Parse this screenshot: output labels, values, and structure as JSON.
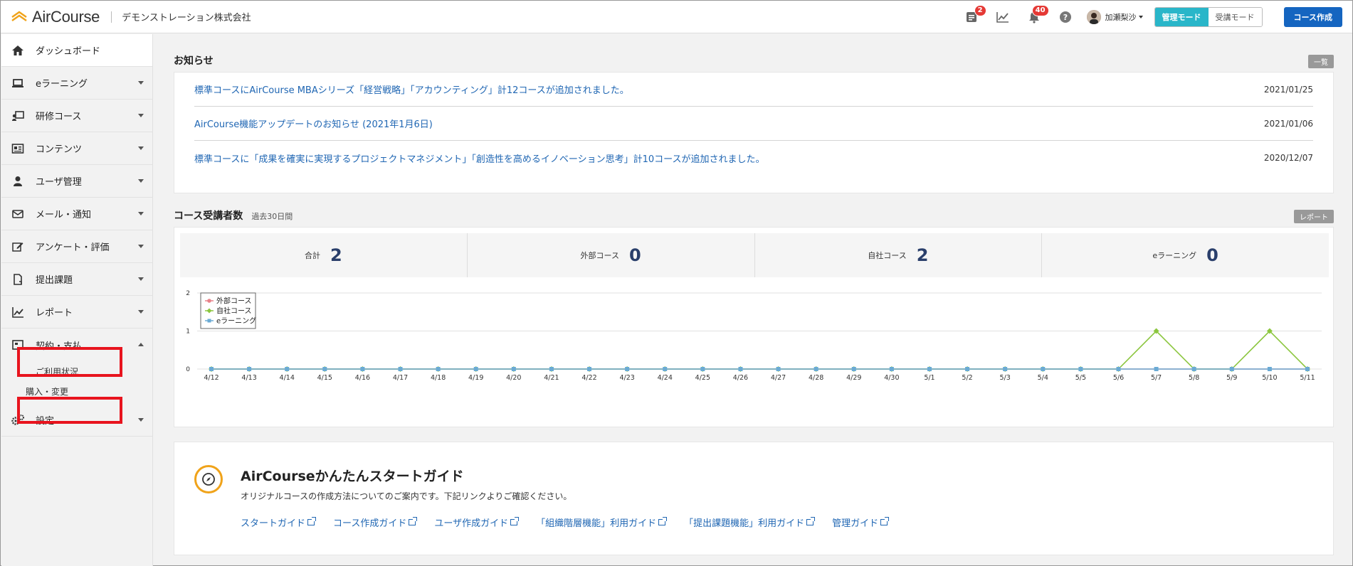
{
  "header": {
    "logo": "AirCourse",
    "company": "デモンストレーション株式会社",
    "notif_tasks_count": "2",
    "notif_bell_count": "40",
    "user_name": "加瀬梨沙",
    "mode_admin": "管理モード",
    "mode_learner": "受講モード",
    "create_course": "コース作成"
  },
  "sidebar": {
    "items": [
      {
        "label": "ダッシュボード",
        "icon": "home-icon"
      },
      {
        "label": "eラーニング",
        "icon": "laptop-icon"
      },
      {
        "label": "研修コース",
        "icon": "presenter-icon"
      },
      {
        "label": "コンテンツ",
        "icon": "contents-icon"
      },
      {
        "label": "ユーザ管理",
        "icon": "user-icon"
      },
      {
        "label": "メール・通知",
        "icon": "mail-icon"
      },
      {
        "label": "アンケート・評価",
        "icon": "edit-icon"
      },
      {
        "label": "提出課題",
        "icon": "file-icon"
      },
      {
        "label": "レポート",
        "icon": "chart-icon"
      },
      {
        "label": "契約・支払",
        "icon": "contract-icon"
      },
      {
        "label": "設定",
        "icon": "gears-icon"
      }
    ],
    "subitems": [
      "ご利用状況",
      "購入・変更"
    ]
  },
  "news": {
    "title": "お知らせ",
    "more": "一覧",
    "items": [
      {
        "text": "標準コースにAirCourse MBAシリーズ「経営戦略」「アカウンティング」計12コースが追加されました。",
        "date": "2021/01/25"
      },
      {
        "text": "AirCourse機能アップデートのお知らせ (2021年1月6日)",
        "date": "2021/01/06"
      },
      {
        "text": "標準コースに「成果を確実に実現するプロジェクトマネジメント」「創造性を高めるイノベーション思考」計10コースが追加されました。",
        "date": "2020/12/07"
      }
    ]
  },
  "stats": {
    "title": "コース受講者数",
    "subtitle": "過去30日間",
    "report": "レポート",
    "cells": [
      {
        "label": "合計",
        "value": "2"
      },
      {
        "label": "外部コース",
        "value": "0"
      },
      {
        "label": "自社コース",
        "value": "2"
      },
      {
        "label": "eラーニング",
        "value": "0"
      }
    ]
  },
  "chart_data": {
    "type": "line",
    "x": [
      "4/12",
      "4/13",
      "4/14",
      "4/15",
      "4/16",
      "4/17",
      "4/18",
      "4/19",
      "4/20",
      "4/21",
      "4/22",
      "4/23",
      "4/24",
      "4/25",
      "4/26",
      "4/27",
      "4/28",
      "4/29",
      "4/30",
      "5/1",
      "5/2",
      "5/3",
      "5/4",
      "5/5",
      "5/6",
      "5/7",
      "5/8",
      "5/9",
      "5/10",
      "5/11"
    ],
    "ylim": [
      0,
      2
    ],
    "yticks": [
      0,
      1,
      2
    ],
    "legend": "top-left",
    "series": [
      {
        "name": "外部コース",
        "color": "#e8838a",
        "marker": "circle",
        "values": [
          0,
          0,
          0,
          0,
          0,
          0,
          0,
          0,
          0,
          0,
          0,
          0,
          0,
          0,
          0,
          0,
          0,
          0,
          0,
          0,
          0,
          0,
          0,
          0,
          0,
          0,
          0,
          0,
          0,
          0
        ]
      },
      {
        "name": "自社コース",
        "color": "#8cc63f",
        "marker": "diamond",
        "values": [
          0,
          0,
          0,
          0,
          0,
          0,
          0,
          0,
          0,
          0,
          0,
          0,
          0,
          0,
          0,
          0,
          0,
          0,
          0,
          0,
          0,
          0,
          0,
          0,
          0,
          1,
          0,
          0,
          1,
          0
        ]
      },
      {
        "name": "eラーニング",
        "color": "#6aaad4",
        "marker": "square",
        "values": [
          0,
          0,
          0,
          0,
          0,
          0,
          0,
          0,
          0,
          0,
          0,
          0,
          0,
          0,
          0,
          0,
          0,
          0,
          0,
          0,
          0,
          0,
          0,
          0,
          0,
          0,
          0,
          0,
          0,
          0
        ]
      }
    ]
  },
  "guide": {
    "title": "AirCourseかんたんスタートガイド",
    "desc": "オリジナルコースの作成方法についてのご案内です。下記リンクよりご確認ください。",
    "links": [
      "スタートガイド",
      "コース作成ガイド",
      "ユーザ作成ガイド",
      "「組織階層機能」利用ガイド",
      "「提出課題機能」利用ガイド",
      "管理ガイド"
    ]
  }
}
